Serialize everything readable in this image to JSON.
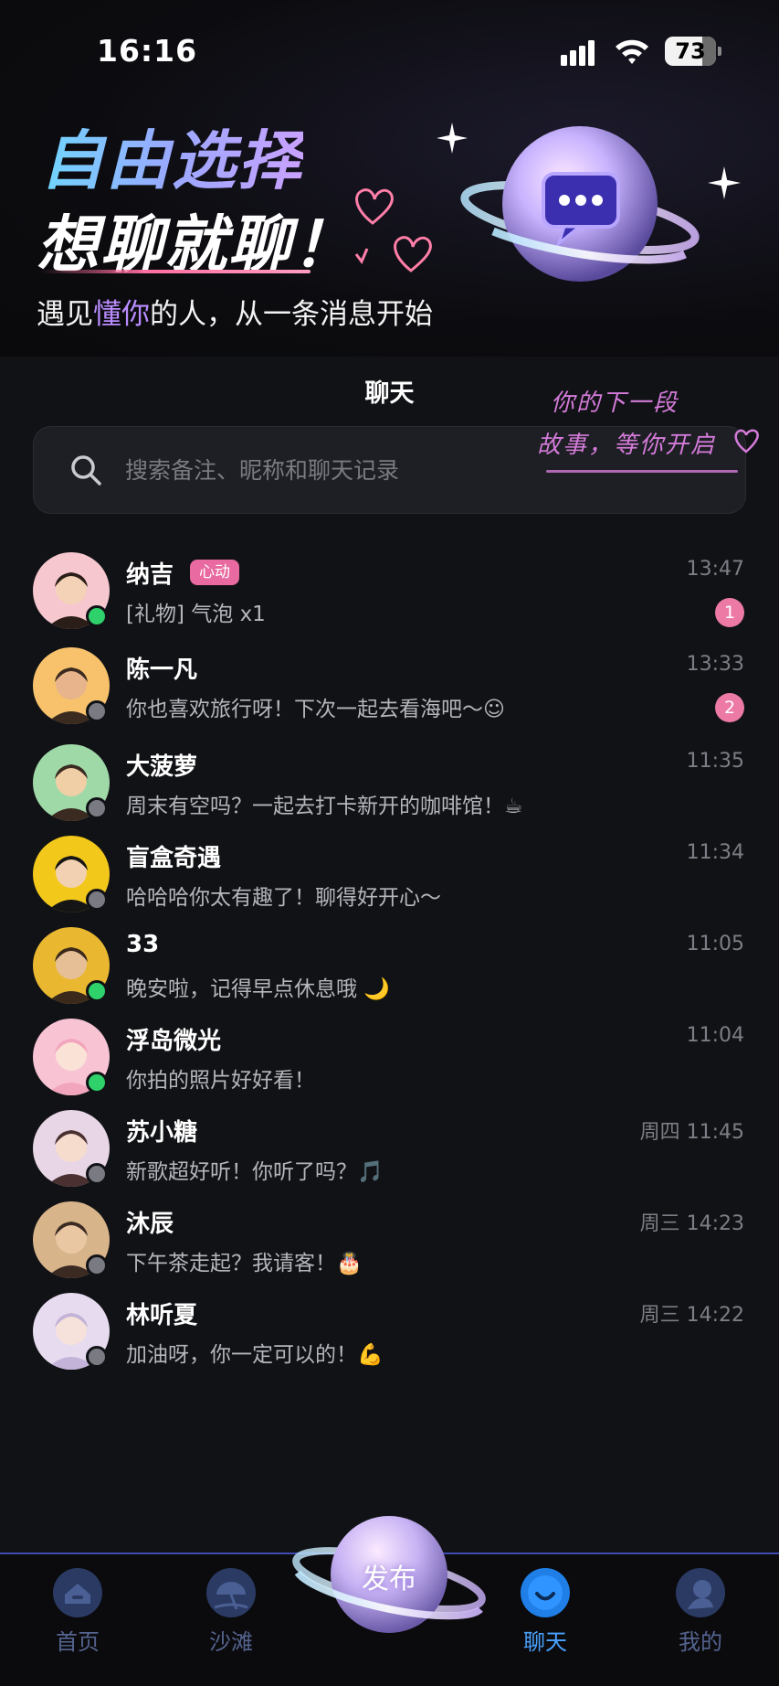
{
  "status_bar": {
    "time": "16:16",
    "battery": "73",
    "battery_fraction": 0.73
  },
  "hero": {
    "title_line1": "自由选择",
    "title_line2": "想聊就聊！",
    "subtitle_before": "遇见",
    "subtitle_highlight": "懂你",
    "subtitle_after": "的人，从一条消息开始"
  },
  "header": {
    "title": "聊天",
    "handwriting_line1": "你的下一段",
    "handwriting_line2": "故事，等你开启"
  },
  "search": {
    "placeholder": "搜索备注、昵称和聊天记录"
  },
  "chats": [
    {
      "name": "纳吉",
      "badge": "心动",
      "preview": "[礼物] 气泡 x1",
      "time": "13:47",
      "unread": "1",
      "online": true
    },
    {
      "name": "陈一凡",
      "preview": "你也喜欢旅行呀！下次一起去看海吧～☺",
      "time": "13:33",
      "unread": "2",
      "online": false
    },
    {
      "name": "大菠萝",
      "preview": "周末有空吗？一起去打卡新开的咖啡馆！☕",
      "time": "11:35",
      "online": false
    },
    {
      "name": "盲盒奇遇",
      "preview": "哈哈哈你太有趣了！聊得好开心～",
      "time": "11:34",
      "online": false
    },
    {
      "name": "33",
      "preview": "晚安啦，记得早点休息哦 🌙",
      "time": "11:05",
      "online": true
    },
    {
      "name": "浮岛微光",
      "preview": "你拍的照片好好看！",
      "time": "11:04",
      "online": true
    },
    {
      "name": "苏小糖",
      "preview": "新歌超好听！你听了吗？🎵",
      "time": "周四 11:45",
      "online": false
    },
    {
      "name": "沐辰",
      "preview": "下午茶走起？我请客！🎂",
      "time": "周三 14:23",
      "online": false
    },
    {
      "name": "林听夏",
      "preview": "加油呀，你一定可以的！💪",
      "time": "周三 14:22",
      "online": false
    }
  ],
  "nav": {
    "home": "首页",
    "beach": "沙滩",
    "publish": "发布",
    "chat": "聊天",
    "me": "我的",
    "active": "chat"
  },
  "colors": {
    "accent": "#4aa3ff",
    "badge_pink": "#e86aa0",
    "online_green": "#2fd16a",
    "highlight_purple": "#b98cff"
  }
}
